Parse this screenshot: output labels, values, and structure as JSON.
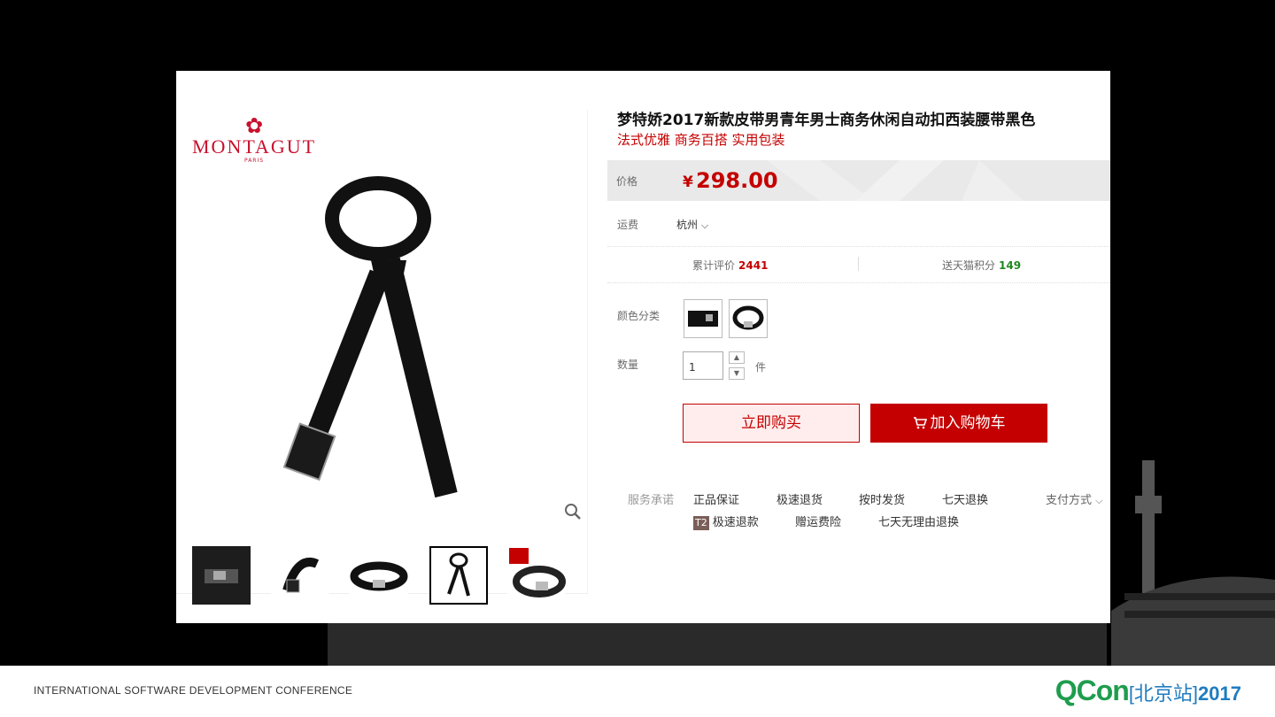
{
  "product": {
    "title": "梦特娇2017新款皮带男青年男士商务休闲自动扣西装腰带黑色",
    "subtitle": "法式优雅 商务百搭 实用包装"
  },
  "brand": {
    "name": "MONTAGUT",
    "sub": "PARIS"
  },
  "price": {
    "label": "价格",
    "currency": "¥",
    "value": "298.00"
  },
  "shipping": {
    "label": "运费",
    "location": "杭州"
  },
  "stats": {
    "reviews_label": "累计评价",
    "reviews_count": "2441",
    "points_label": "送天猫积分",
    "points_count": "149"
  },
  "color": {
    "label": "颜色分类"
  },
  "quantity": {
    "label": "数量",
    "value": "1",
    "unit": "件"
  },
  "buttons": {
    "buy_now": "立即购买",
    "add_to_cart": "加入购物车"
  },
  "service": {
    "label": "服务承诺",
    "items": [
      "正品保证",
      "极速退货",
      "按时发货",
      "七天退换"
    ],
    "payment": "支付方式",
    "badge": "T2",
    "items2": [
      "极速退款",
      "赠运费险",
      "七天无理由退换"
    ]
  },
  "footer": {
    "conference": "INTERNATIONAL SOFTWARE DEVELOPMENT CONFERENCE",
    "logo": "QCon",
    "site": "[北京站]",
    "year": "2017"
  },
  "colors": {
    "accent": "#c40000",
    "green": "#1f9d4e"
  }
}
